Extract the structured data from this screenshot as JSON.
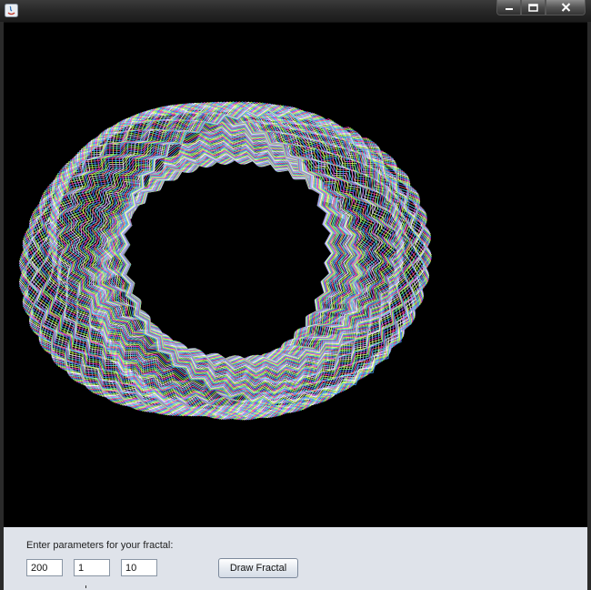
{
  "window": {
    "title": ""
  },
  "title_controls": {
    "minimize": "minimize-icon",
    "maximize": "maximize-icon",
    "close": "close-icon"
  },
  "controls": {
    "prompt": "Enter parameters for your fractal:",
    "param1": "200",
    "param2": "1",
    "param3": "10",
    "draw_label": "Draw Fractal"
  },
  "colors": {
    "titlebar": "#262626",
    "canvas_bg": "#000000",
    "panel_bg": "#dfe3ea",
    "fractal_palette": [
      "#ff3cd2",
      "#e8ff5a",
      "#6cff9a",
      "#4d6dff",
      "#ff5a7a",
      "#58e6ff",
      "#c98cff",
      "#ffffff",
      "#b8ff4a",
      "#3fa0ff"
    ]
  }
}
